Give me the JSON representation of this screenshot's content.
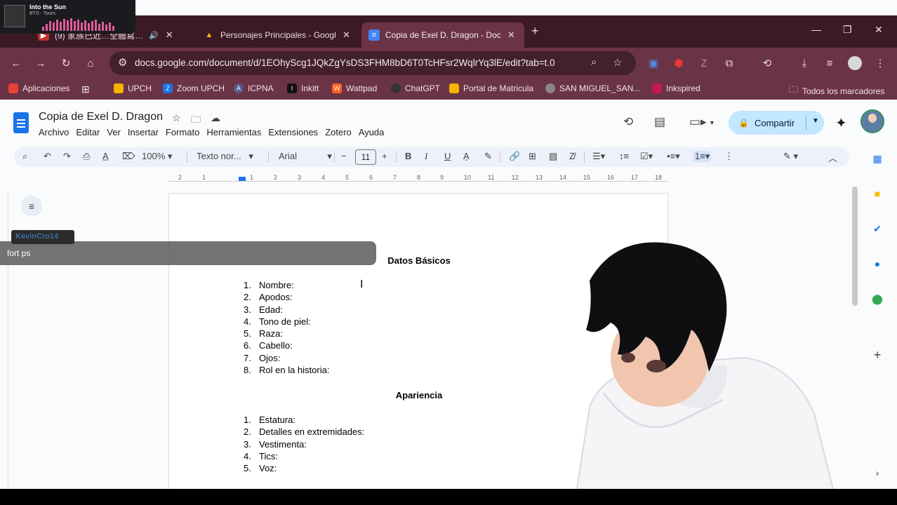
{
  "now_playing": {
    "title": "Into the Sun",
    "artist": "BTS - Tours"
  },
  "tabs": [
    {
      "title": "(9) 家族已近…全體寫…",
      "active": false
    },
    {
      "title": "Personajes Principales - Google",
      "active": false
    },
    {
      "title": "Copia de Exel D. Dragon - Doc",
      "active": true
    }
  ],
  "address_bar": {
    "url": "docs.google.com/document/d/1EOhyScg1JQkZgYsDS3FHM8bD6T0TcHFsr2WqlrYq3lE/edit?tab=t.0"
  },
  "bookmarks": [
    {
      "label": "Aplicaciones",
      "color": "#ea4335"
    },
    {
      "label": "UPCH",
      "color": "#f4b400"
    },
    {
      "label": "Zoom UPCH",
      "color": "#1a73e8"
    },
    {
      "label": "ICPNA",
      "color": "#5a5a8a"
    },
    {
      "label": "Inkitt",
      "color": "#111111"
    },
    {
      "label": "Wattpad",
      "color": "#ff6122"
    },
    {
      "label": "ChatGPT",
      "color": "#333333"
    },
    {
      "label": "Portal de Matricula",
      "color": "#f4b400"
    },
    {
      "label": "SAN MIGUEL_SAN...",
      "color": "#888888"
    },
    {
      "label": "Inkspired",
      "color": "#c2185b"
    }
  ],
  "all_bookmarks_label": "Todos los marcadores",
  "doc": {
    "title": "Copia de Exel D. Dragon",
    "menu": [
      "Archivo",
      "Editar",
      "Ver",
      "Insertar",
      "Formato",
      "Herramientas",
      "Extensiones",
      "Zotero",
      "Ayuda"
    ],
    "share_label": "Compartir"
  },
  "format_toolbar": {
    "zoom": "100%",
    "style": "Texto nor...",
    "font": "Arial",
    "font_size": "11"
  },
  "ruler_ticks": [
    "2",
    "1",
    "1",
    "2",
    "3",
    "4",
    "5",
    "6",
    "7",
    "8",
    "9",
    "10",
    "11",
    "12",
    "13",
    "14",
    "15",
    "16",
    "17",
    "18"
  ],
  "content": {
    "section1_title": "Datos Básicos",
    "section1_items": [
      "Nombre:",
      "Apodos:",
      "Edad:",
      "Tono de piel:",
      "Raza:",
      "Cabello:",
      "Ojos:",
      "Rol en la historia:"
    ],
    "section2_title": "Apariencia",
    "section2_items": [
      "Estatura:",
      "Detalles en extremidades:",
      "Vestimenta:",
      "Tics:",
      "Voz:"
    ]
  },
  "chat": {
    "username": "KevinCro14",
    "message": "fort ps"
  }
}
